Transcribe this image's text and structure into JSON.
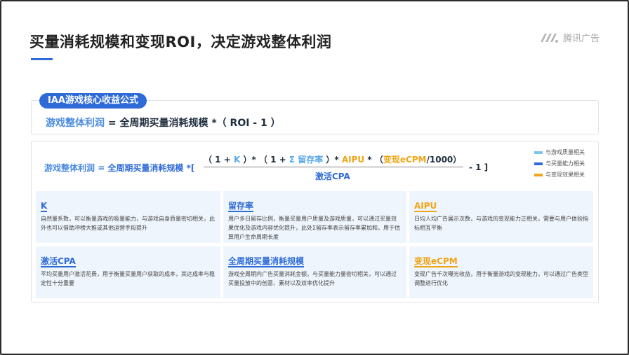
{
  "header": {
    "title": "买量消耗规模和变现ROI，决定游戏整体利润",
    "brand": "腾讯广告",
    "brand_icon": "tencent-ads-logo-icon"
  },
  "formula_core": {
    "tag": "IAA游戏核心收益公式",
    "lhs": "游戏整体利润",
    "rhs": " = 全周期买量消耗规模 *（ ROI - 1 ）"
  },
  "formula_detail": {
    "lhs": "游戏整体利润",
    "eq": " = 全周期买量消耗规模 *[",
    "numer_open": "（ 1 + ",
    "k": "K",
    "numer_mid1": " ）* （ 1 + ",
    "ret": "Σ 留存率",
    "numer_mid2": " ）* ",
    "aipu": "AIPU",
    "numer_mid3": " * （",
    "ecpm": "变现eCPM",
    "numer_close": "/1000）",
    "denom": "激活CPA",
    "tail": "- 1 ]"
  },
  "legend": [
    {
      "label": "与游戏质量相关",
      "color": "#7cc4ee"
    },
    {
      "label": "与买量能力相关",
      "color": "#2f6bd8"
    },
    {
      "label": "与变现效果相关",
      "color": "#f0a516"
    }
  ],
  "cards": [
    {
      "title": "K",
      "color": "#2f6bd8",
      "desc": "自然量系数，可以衡量游戏的吸量能力，与游戏自身质量密切相关，此外也可以借助冲榜大推或其他运营手段提升"
    },
    {
      "title": "留存率",
      "color": "#2f6bd8",
      "desc": "用户多日留存比例，衡量买量用户质量及游戏质量，可以通过买量效果优化及游戏内容优化提升，此处Σ留存率表示留存率累加和，用于估算用户生命周期长度"
    },
    {
      "title": "AIPU",
      "color": "#f0a516",
      "desc": "日均人均广告展示次数，与游戏的变现能力正相关，需要与用户体验指标相互平衡"
    },
    {
      "title": "激活CPA",
      "color": "#2f6bd8",
      "desc": "平均买量用户激活花费，用于衡量买量用户获取的成本，其达成率与稳定性十分重要"
    },
    {
      "title": "全周期买量消耗规模",
      "color": "#2f6bd8",
      "desc": "游戏全周期内广告买量消耗金额，与买量能力量密切相关，可以通过买量投放中的创意、素材以及双率优化提升"
    },
    {
      "title": "变现eCPM",
      "color": "#f0a516",
      "desc": "变现广告千次曝光收益，用于衡量游戏的变现能力，可以通过广告类型调整进行优化"
    }
  ]
}
